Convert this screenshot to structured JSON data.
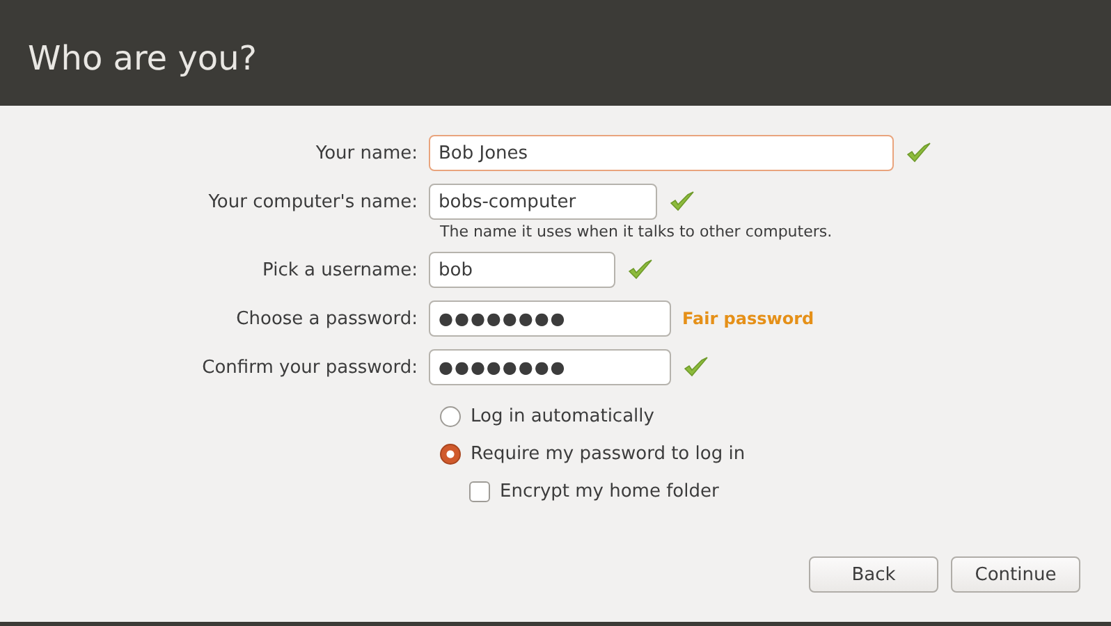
{
  "header": {
    "title": "Who are you?"
  },
  "fields": [
    {
      "label": "Your name:",
      "value": "Bob Jones",
      "kind": "text",
      "focused": true,
      "valid": true
    },
    {
      "label": "Your computer's name:",
      "value": "bobs-computer",
      "kind": "text",
      "focused": false,
      "valid": true,
      "hint": "The name it uses when it talks to other computers."
    },
    {
      "label": "Pick a username:",
      "value": "bob",
      "kind": "text",
      "focused": false,
      "valid": true
    },
    {
      "label": "Choose a password:",
      "value": "●●●●●●●●",
      "kind": "password",
      "focused": false,
      "valid": false,
      "strength": "Fair password"
    },
    {
      "label": "Confirm your password:",
      "value": "●●●●●●●●",
      "kind": "password",
      "focused": false,
      "valid": true
    }
  ],
  "login_options": [
    {
      "label": "Log in automatically",
      "selected": false
    },
    {
      "label": "Require my password to log in",
      "selected": true
    }
  ],
  "encrypt": {
    "label": "Encrypt my home folder",
    "checked": false
  },
  "buttons": [
    {
      "label": "Back"
    },
    {
      "label": "Continue"
    }
  ]
}
